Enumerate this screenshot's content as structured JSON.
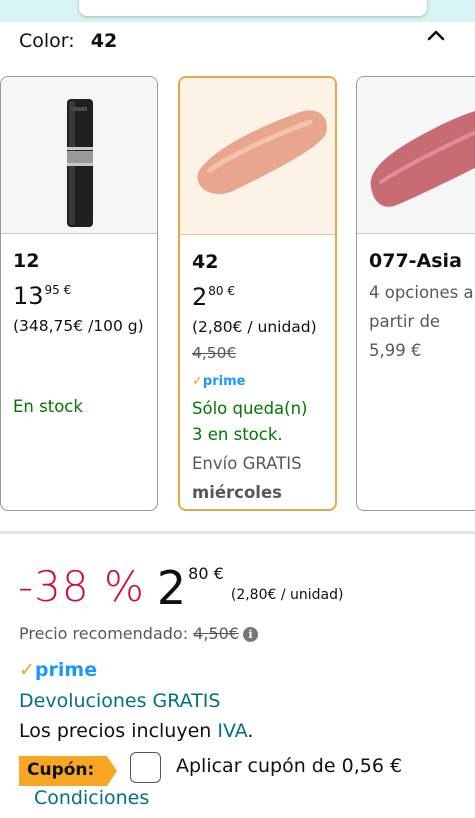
{
  "color_selector": {
    "label": "Color:",
    "value": "42"
  },
  "variants": [
    {
      "name": "12",
      "price_whole": "13",
      "price_fraction": "95",
      "currency": "€",
      "unit_price": "(348,75€ /100 g)",
      "availability": "En stock"
    },
    {
      "name": "42",
      "price_whole": "2",
      "price_fraction": "80",
      "currency": "€",
      "unit_price": "(2,80€ / unidad)",
      "list_price": "4,50€",
      "prime": "prime",
      "stock_line1": "Sólo queda(n)",
      "stock_line2": "3 en stock.",
      "shipping": "Envío GRATIS",
      "delivery_day": "miércoles"
    },
    {
      "name": "077-Asia",
      "options_line1": "4 opciones a",
      "options_line2": "partir de",
      "options_line3": "5,99 €"
    }
  ],
  "deal": {
    "discount": "-38 %",
    "price_whole": "2",
    "price_fraction": "80 €",
    "unit_price": "(2,80€ / unidad)"
  },
  "recommended": {
    "label": "Precio recomendado:",
    "value": "4,50€"
  },
  "prime_label": "prime",
  "returns": "Devoluciones GRATIS",
  "taxes": {
    "text": "Los precios incluyen",
    "link": "IVA",
    "end": "."
  },
  "coupon": {
    "tag": "Cupón:",
    "text": "Aplicar cupón de 0,56 €",
    "conditions": "Condiciones"
  },
  "colors": {
    "accent_orange": "#e7a64a",
    "deal_red": "#cc0c39",
    "stock_green": "#007600",
    "link_teal": "#007185",
    "prime_blue": "#1a98ff",
    "coupon_orange": "#f7a623"
  }
}
